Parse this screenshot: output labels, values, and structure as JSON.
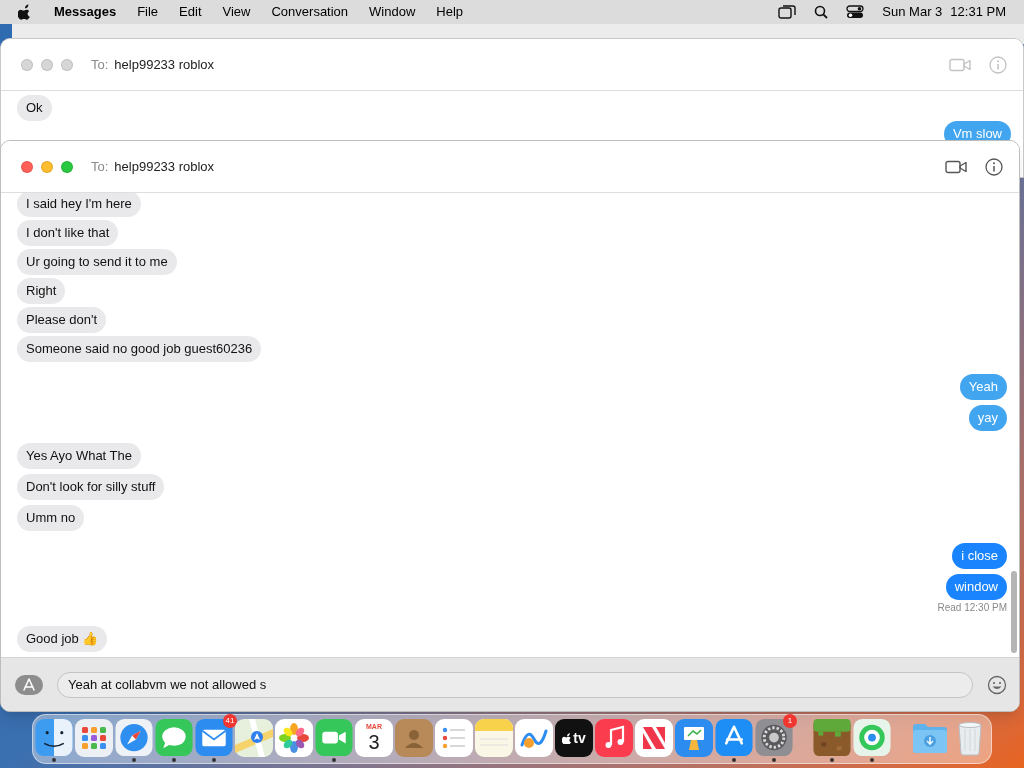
{
  "menu_bar": {
    "app_name": "Messages",
    "menus": [
      "File",
      "Edit",
      "View",
      "Conversation",
      "Window",
      "Help"
    ],
    "date": "Sun Mar 3",
    "time": "12:31 PM"
  },
  "back_window": {
    "to_label": "To:",
    "recipient": "help99233 roblox",
    "active": false,
    "messages": [
      {
        "kind": "received",
        "text": "Ok"
      },
      {
        "kind": "sent",
        "text": "Vm slow"
      }
    ]
  },
  "front_window": {
    "to_label": "To:",
    "recipient": "help99233 roblox",
    "active": true,
    "groups": [
      [
        {
          "kind": "received",
          "text": "I said hey I'm here"
        },
        {
          "kind": "received",
          "text": "I don't like that"
        },
        {
          "kind": "received",
          "text": "Ur going to send it to me"
        },
        {
          "kind": "received",
          "text": "Right"
        },
        {
          "kind": "received",
          "text": "Please don't"
        },
        {
          "kind": "received",
          "text": "Someone said no good job guest60236"
        }
      ],
      [
        {
          "kind": "sent",
          "text": "Yeah",
          "imessage": false
        },
        {
          "kind": "sent",
          "text": "yay",
          "imessage": false
        }
      ],
      [
        {
          "kind": "received",
          "text": "Yes Ayo What The"
        },
        {
          "kind": "received",
          "text": "Don't look for silly stuff"
        },
        {
          "kind": "received",
          "text": "Umm no"
        }
      ],
      [
        {
          "kind": "sent",
          "text": "i close",
          "imessage": true
        },
        {
          "kind": "sent",
          "text": "window",
          "imessage": true
        },
        {
          "kind": "receipt",
          "text": "Read 12:30 PM"
        }
      ],
      [
        {
          "kind": "received",
          "text": "Good job 👍"
        }
      ]
    ],
    "compose": {
      "value": "Yeah at collabvm we not allowed s"
    }
  },
  "dock": {
    "apps": [
      {
        "kind": "finder",
        "running": true
      },
      {
        "kind": "launchpad",
        "running": false
      },
      {
        "kind": "safari",
        "running": true
      },
      {
        "kind": "messages",
        "running": true
      },
      {
        "kind": "mail",
        "running": true,
        "badge": "41"
      },
      {
        "kind": "maps",
        "running": false
      },
      {
        "kind": "photos",
        "running": false
      },
      {
        "kind": "facetime",
        "running": true
      },
      {
        "kind": "calendar",
        "running": false,
        "month": "MAR",
        "day": "3"
      },
      {
        "kind": "contacts",
        "running": false
      },
      {
        "kind": "reminders",
        "running": false
      },
      {
        "kind": "notes",
        "running": false
      },
      {
        "kind": "freeform",
        "running": false
      },
      {
        "kind": "tv",
        "running": false,
        "label": "tv"
      },
      {
        "kind": "music",
        "running": false
      },
      {
        "kind": "news",
        "running": false
      },
      {
        "kind": "keynote",
        "running": false
      },
      {
        "kind": "appstore",
        "running": true
      },
      {
        "kind": "settings",
        "running": true,
        "badge": "1"
      },
      {
        "kind": "separator"
      },
      {
        "kind": "minecraft",
        "running": true
      },
      {
        "kind": "findmy",
        "running": true
      },
      {
        "kind": "separator"
      },
      {
        "kind": "downloads",
        "running": false
      },
      {
        "kind": "trash",
        "running": false
      }
    ]
  }
}
